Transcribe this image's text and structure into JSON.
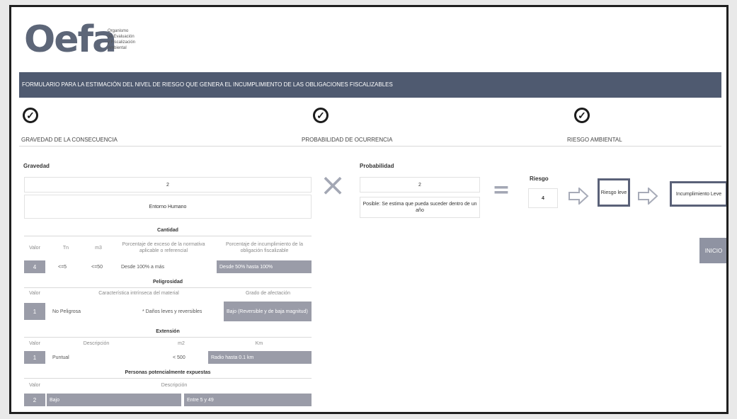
{
  "brand": {
    "logo_text": "Oefa",
    "subtitle_line1": "Organismo",
    "subtitle_line2": "de Evaluación",
    "subtitle_line3": "y Fiscalización",
    "subtitle_line4": "Ambiental"
  },
  "banner_title": "FORMULARIO PARA LA ESTIMACIÓN DEL NIVEL DE RIESGO QUE GENERA EL INCUMPLIMIENTO DE LAS OBLIGACIONES FISCALIZABLES",
  "steps": [
    {
      "label": "GRAVEDAD DE LA CONSECUENCIA",
      "icon": "check-circle-icon"
    },
    {
      "label": "PROBABILIDAD DE OCURRENCIA",
      "icon": "check-circle-icon"
    },
    {
      "label": "RIESGO AMBIENTAL",
      "icon": "check-circle-icon"
    }
  ],
  "gravedad": {
    "title": "Gravedad",
    "value": "2",
    "entorno": "Entorno Humano",
    "cantidad": {
      "title": "Cantidad",
      "headers": [
        "Valor",
        "Tn",
        "m3",
        "Porcentaje de exceso de la normativa aplicable o referencial",
        "Porcentaje de incumplimiento de la obligación fiscalizable"
      ],
      "row": {
        "valor": "4",
        "tn": "<=5",
        "m3": "<=50",
        "porcentaje": "Desde 100% a más",
        "incumplimiento": "Desde 50% hasta 100%"
      }
    },
    "peligrosidad": {
      "title": "Peligrosidad",
      "headers": [
        "Valor",
        "Característica intrínseca del material",
        "Grado de afectación"
      ],
      "row": {
        "valor": "1",
        "caracteristica": "No Peligrosa",
        "afectacion_text": "* Daños leves y reversibles",
        "grado": "Bajo (Reversible y de baja magnitud)"
      }
    },
    "extension": {
      "title": "Extensión",
      "headers": [
        "Valor",
        "Descripción",
        "m2",
        "Km"
      ],
      "row": {
        "valor": "1",
        "descripcion": "Puntual",
        "m2": "< 500",
        "km": "Radio hasta 0.1 km"
      }
    },
    "personas": {
      "title": "Personas potencialmente expuestas",
      "headers": [
        "Valor",
        "Descripción"
      ],
      "row": {
        "valor": "2",
        "descripcion": "Bajo",
        "rango": "Entre 5 y 49"
      }
    }
  },
  "operators": {
    "times": "×",
    "equals": "="
  },
  "probabilidad": {
    "title": "Probabilidad",
    "value": "2",
    "description": "Posible: Se estima que pueda suceder dentro de un año"
  },
  "riesgo": {
    "title": "Riesgo",
    "value": "4",
    "level": "Riesgo leve",
    "result": "Incumplimiento Leve"
  },
  "inicio_button": "INICIO",
  "colors": {
    "banner": "#4f5a70",
    "gray_box": "#9a9ca8",
    "arrow": "#a7abb8"
  }
}
